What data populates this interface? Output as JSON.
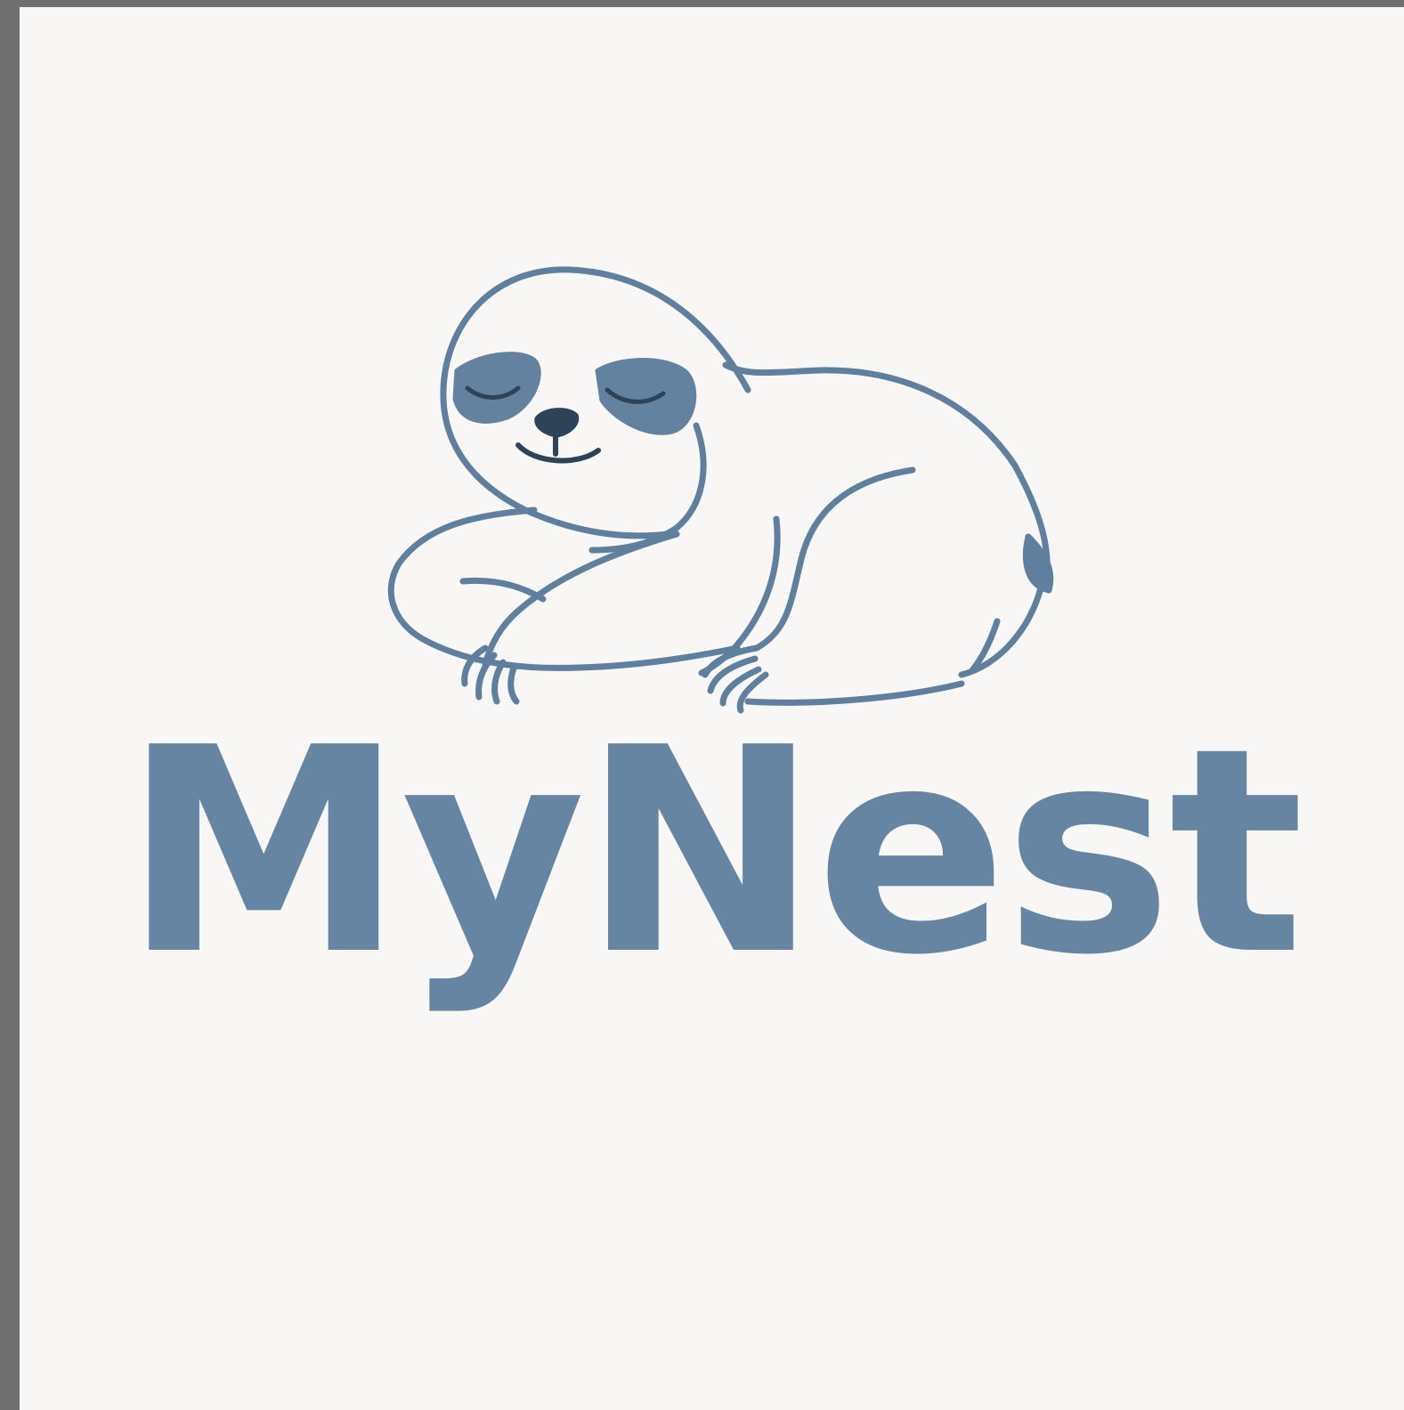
{
  "logo": {
    "brand_name": "MyNest",
    "mascot_icon": "sleeping-sloth-icon",
    "colors": {
      "line": "#5f7f9e",
      "eye_patch": "#6382a0",
      "nose": "#2e4358",
      "text": "#6685a3",
      "background": "#f8f7f5",
      "frame": "#707070"
    }
  }
}
